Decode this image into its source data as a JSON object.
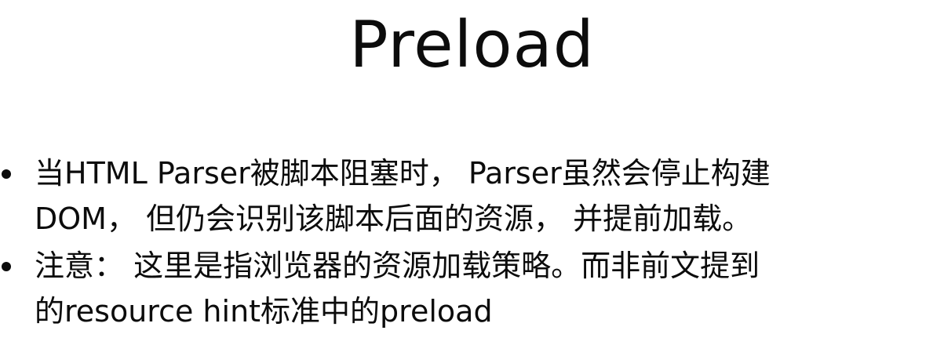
{
  "slide": {
    "title": "Preload",
    "bullets": [
      {
        "lines": [
          "当HTML Parser被脚本阻塞时， Parser虽然会停止构建",
          "DOM， 但仍会识别该脚本后面的资源， 并提前加载。"
        ]
      },
      {
        "lines": [
          "注意： 这里是指浏览器的资源加载策略。而非前文提到",
          "的resource hint标准中的preload"
        ]
      }
    ]
  }
}
